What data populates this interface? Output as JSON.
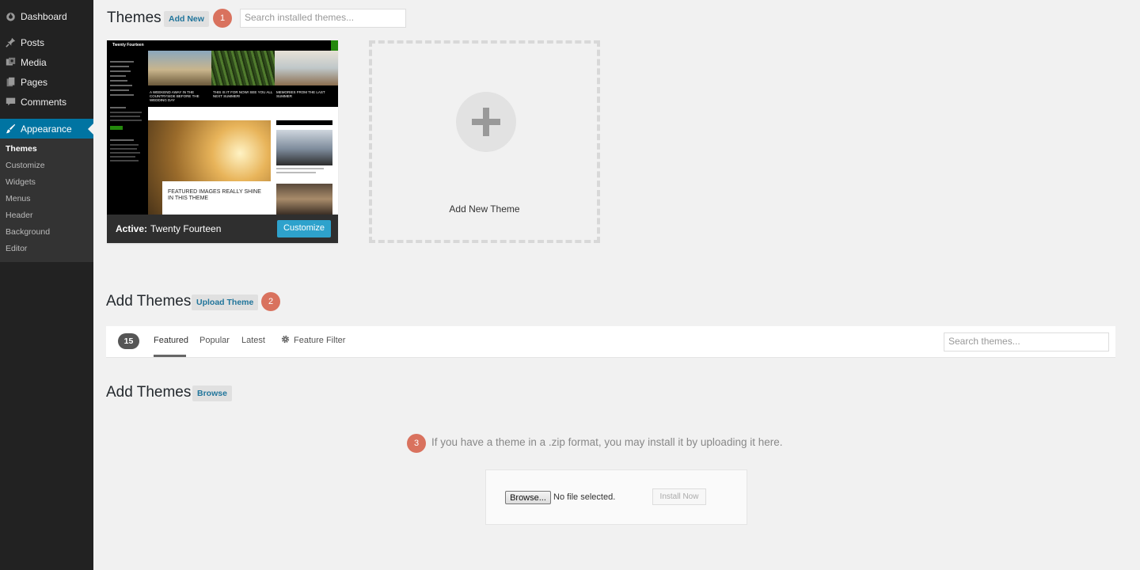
{
  "sidebar": {
    "items": [
      {
        "label": "Dashboard",
        "icon": "dashboard-icon"
      },
      {
        "label": "Posts",
        "icon": "pin-icon"
      },
      {
        "label": "Media",
        "icon": "media-icon"
      },
      {
        "label": "Pages",
        "icon": "pages-icon"
      },
      {
        "label": "Comments",
        "icon": "comment-icon"
      },
      {
        "label": "Appearance",
        "icon": "paintbrush-icon"
      }
    ],
    "submenu": [
      "Themes",
      "Customize",
      "Widgets",
      "Menus",
      "Header",
      "Background",
      "Editor"
    ]
  },
  "themes_section": {
    "title": "Themes",
    "add_new_label": "Add New",
    "step": "1",
    "search_placeholder": "Search installed themes..."
  },
  "active_theme": {
    "prefix": "Active:",
    "name": "Twenty Fourteen",
    "customize_label": "Customize",
    "preview_site_title": "Twenty Fourteen",
    "preview_headlines": [
      "A WEEKEND AWAY IN THE COUNTRYSIDE BEFORE THE WEDDING DAY",
      "THIS IS IT FOR NOW! SEE YOU ALL NEXT SUMMER!",
      "MEMORIES FROM THE LAST SUMMER"
    ],
    "preview_featured": "FEATURED IMAGES REALLY SHINE IN THIS THEME"
  },
  "add_new_theme": {
    "label": "Add New Theme"
  },
  "add_themes_upload": {
    "title": "Add Themes",
    "button_label": "Upload Theme",
    "step": "2"
  },
  "filter_bar": {
    "count": "15",
    "tabs": [
      "Featured",
      "Popular",
      "Latest"
    ],
    "feature_filter_label": "Feature Filter",
    "search_placeholder": "Search themes..."
  },
  "add_themes_browse": {
    "title": "Add Themes",
    "button_label": "Browse",
    "step": "3",
    "instruction": "If you have a theme in a .zip format, you may install it by uploading it here."
  },
  "upload_form": {
    "browse_label": "Browse...",
    "file_status": "No file selected.",
    "install_label": "Install Now"
  },
  "colors": {
    "sidebar_bg": "#222222",
    "active_menu": "#0074a2",
    "badge": "#d9725e",
    "customize_button": "#2ea2cc"
  }
}
